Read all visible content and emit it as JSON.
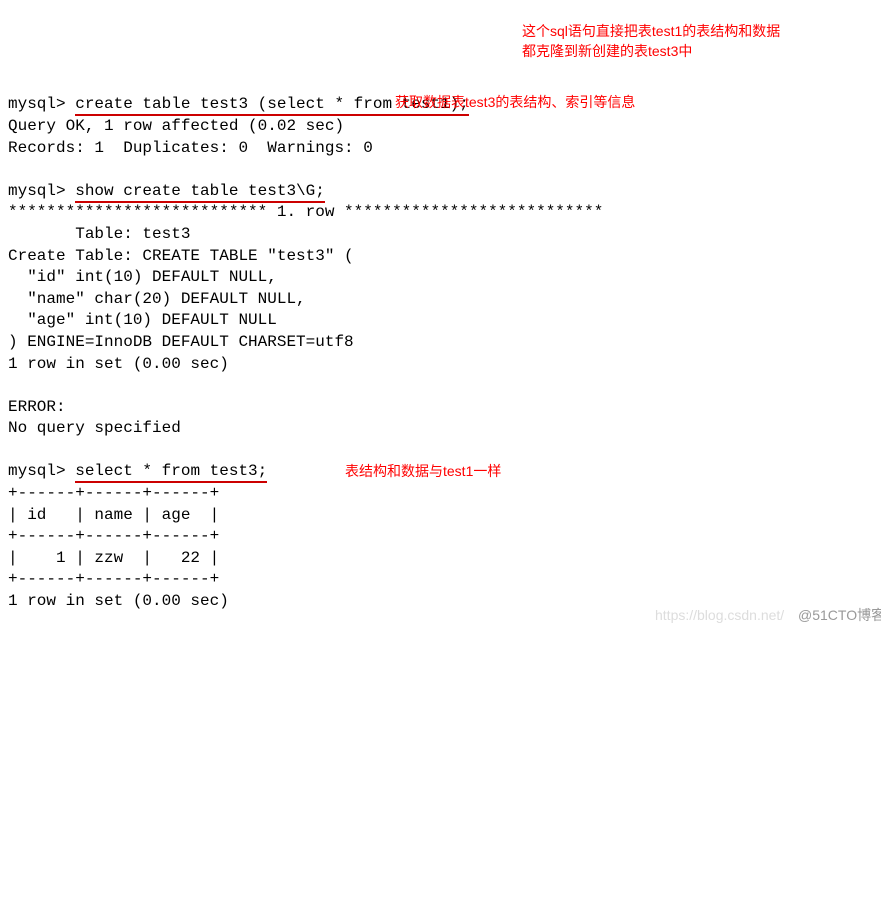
{
  "prompt": "mysql>",
  "cmd1": "create table test3 (select * from test1);",
  "cmd1_result_line1": "Query OK, 1 row affected (0.02 sec)",
  "cmd1_result_line2": "Records: 1  Duplicates: 0  Warnings: 0",
  "annotation1_line1": "这个sql语句直接把表test1的表结构和数据",
  "annotation1_line2": "都克隆到新创建的表test3中",
  "cmd2": "show create table test3\\G;",
  "annotation2": "获取数据表test3的表结构、索引等信息",
  "cmd2_row_sep": "*************************** 1. row ***************************",
  "cmd2_table_line": "       Table: test3",
  "cmd2_ct_line1": "Create Table: CREATE TABLE \"test3\" (",
  "cmd2_ct_line2": "  \"id\" int(10) DEFAULT NULL,",
  "cmd2_ct_line3": "  \"name\" char(20) DEFAULT NULL,",
  "cmd2_ct_line4": "  \"age\" int(10) DEFAULT NULL",
  "cmd2_ct_line5": ") ENGINE=InnoDB DEFAULT CHARSET=utf8",
  "cmd2_result_line": "1 row in set (0.00 sec)",
  "error_line1": "ERROR:",
  "error_line2": "No query specified",
  "cmd3": "select * from test3;",
  "annotation3": "表结构和数据与test1一样",
  "table_border": "+------+------+------+",
  "table_header": "| id   | name | age  |",
  "table_row1": "|    1 | zzw  |   22 |",
  "cmd3_result_line": "1 row in set (0.00 sec)",
  "watermark1": "https://blog.csdn.net/",
  "watermark2": "@51CTO博客",
  "chart_data": {
    "type": "table",
    "columns": [
      "id",
      "name",
      "age"
    ],
    "rows": [
      [
        1,
        "zzw",
        22
      ]
    ]
  }
}
